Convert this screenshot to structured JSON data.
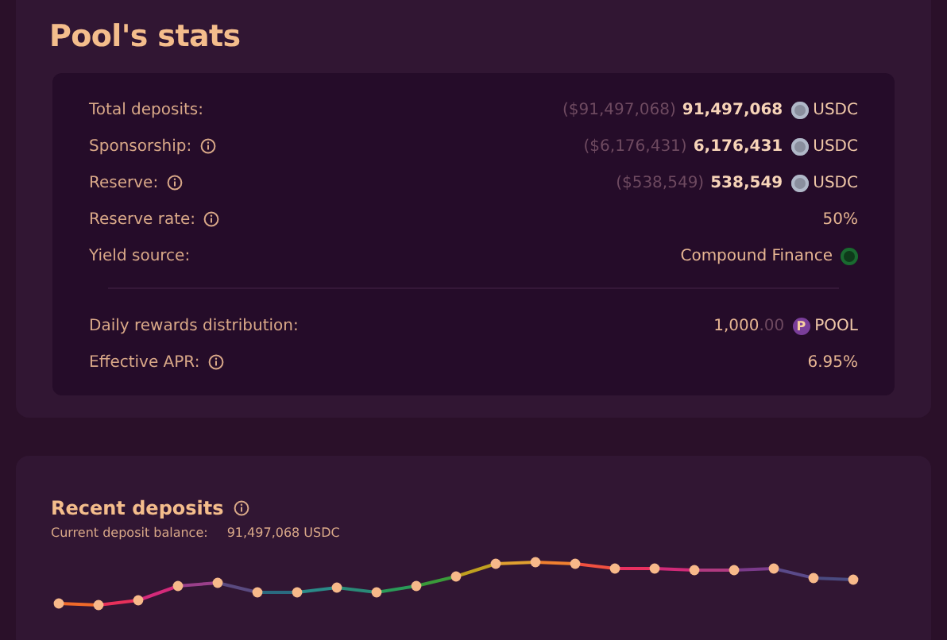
{
  "stats": {
    "title": "Pool's stats",
    "groups": [
      [
        {
          "label": "Total deposits:",
          "info": false,
          "usd": "($91,497,068)",
          "amount": "91,497,068",
          "token": "USDC",
          "kind": "usdc"
        },
        {
          "label": "Sponsorship:",
          "info": true,
          "usd": "($6,176,431)",
          "amount": "6,176,431",
          "token": "USDC",
          "kind": "usdc"
        },
        {
          "label": "Reserve:",
          "info": true,
          "usd": "($538,549)",
          "amount": "538,549",
          "token": "USDC",
          "kind": "usdc"
        },
        {
          "label": "Reserve rate:",
          "info": true,
          "value": "50%"
        },
        {
          "label": "Yield source:",
          "info": false,
          "value": "Compound Finance",
          "kind": "compound"
        }
      ],
      [
        {
          "label": "Daily rewards distribution:",
          "info": false,
          "value": "1,000",
          "decimals": ".00",
          "token": "POOL",
          "kind": "pool",
          "icon_text": "P"
        },
        {
          "label": "Effective APR:",
          "info": true,
          "value": "6.95%"
        }
      ]
    ]
  },
  "deposits": {
    "title": "Recent deposits",
    "info": true,
    "balance_label": "Current deposit balance:",
    "balance": "91,497,068 USDC",
    "chart": {
      "kind": "sparkline"
    }
  }
}
